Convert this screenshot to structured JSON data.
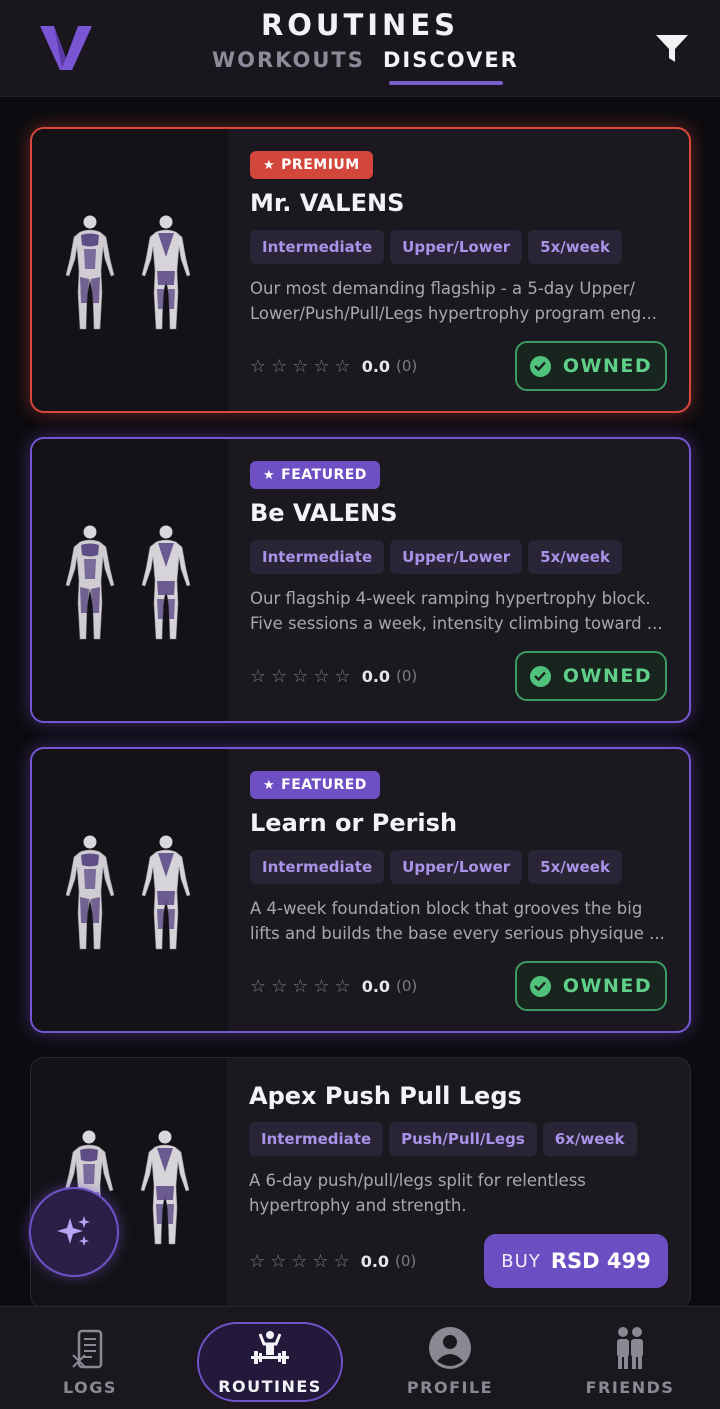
{
  "header": {
    "title": "ROUTINES",
    "tabs": [
      {
        "label": "WORKOUTS",
        "active": false
      },
      {
        "label": "DISCOVER",
        "active": true
      }
    ],
    "logo_icon": "valens-v-logo",
    "filter_icon": "filter-icon"
  },
  "colors": {
    "accent": "#7b5ccb",
    "premium": "#d2463c",
    "owned": "#50c27b",
    "background": "#0c0b0f"
  },
  "routines": [
    {
      "badge": "PREMIUM",
      "title": "Mr. VALENS",
      "tags": [
        "Intermediate",
        "Upper/Lower",
        "5x/week"
      ],
      "desc_line1": "Our most demanding flagship - a 5-day Upper/",
      "desc_line2": "Lower/Push/Pull/Legs hypertrophy program eng...",
      "rating": "0.0",
      "rating_count": "(0)",
      "action": "OWNED"
    },
    {
      "badge": "FEATURED",
      "title": "Be VALENS",
      "tags": [
        "Intermediate",
        "Upper/Lower",
        "5x/week"
      ],
      "desc_line1": "Our flagship 4-week ramping hypertrophy block.",
      "desc_line2": "Five sessions a week, intensity climbing toward ...",
      "rating": "0.0",
      "rating_count": "(0)",
      "action": "OWNED"
    },
    {
      "badge": "FEATURED",
      "title": "Learn or Perish",
      "tags": [
        "Intermediate",
        "Upper/Lower",
        "5x/week"
      ],
      "desc_line1": "A 4-week foundation block that grooves the big",
      "desc_line2": "lifts and builds the base every serious physique ...",
      "rating": "0.0",
      "rating_count": "(0)",
      "action": "OWNED"
    },
    {
      "title": "Apex Push Pull Legs",
      "tags": [
        "Intermediate",
        "Push/Pull/Legs",
        "6x/week"
      ],
      "desc_line1": "A 6-day push/pull/legs split for relentless",
      "desc_line2": "hypertrophy and strength.",
      "rating": "0.0",
      "rating_count": "(0)",
      "buy_label": "BUY",
      "price": "RSD 499"
    }
  ],
  "fab_icon": "sparkles-icon",
  "bottom_nav": [
    {
      "label": "LOGS",
      "icon": "logs-icon"
    },
    {
      "label": "ROUTINES",
      "icon": "routines-icon",
      "active": true
    },
    {
      "label": "PROFILE",
      "icon": "profile-icon"
    },
    {
      "label": "FRIENDS",
      "icon": "friends-icon"
    }
  ]
}
